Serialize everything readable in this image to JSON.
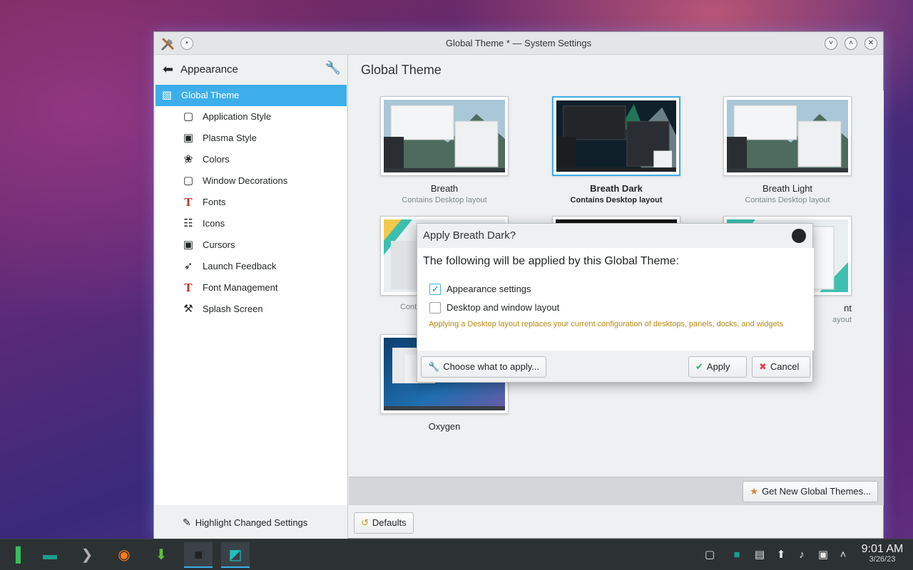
{
  "window": {
    "title": "Global Theme * — System Settings",
    "pin_glyph": "•",
    "controls": [
      {
        "name": "minimize-button",
        "icon": "chevron-down-icon",
        "glyph": "˅"
      },
      {
        "name": "maximize-button",
        "icon": "chevron-up-icon",
        "glyph": "˄"
      },
      {
        "name": "close-button",
        "icon": "close-icon",
        "glyph": "✕"
      }
    ]
  },
  "sidebar": {
    "title": "Appearance",
    "back_glyph": "⬅",
    "tools_glyph": "🔧",
    "items": [
      {
        "label": "Global Theme",
        "icon": "global-theme-icon",
        "glyph": "▧",
        "selected": true,
        "indent": false
      },
      {
        "label": "Application Style",
        "icon": "application-style-icon",
        "glyph": "▢",
        "indent": true
      },
      {
        "label": "Plasma Style",
        "icon": "plasma-style-icon",
        "glyph": "▣",
        "indent": true
      },
      {
        "label": "Colors",
        "icon": "colors-icon",
        "glyph": "❀",
        "indent": true
      },
      {
        "label": "Window Decorations",
        "icon": "window-decorations-icon",
        "glyph": "▢",
        "indent": true
      },
      {
        "label": "Fonts",
        "icon": "fonts-icon",
        "glyph": "T",
        "indent": true
      },
      {
        "label": "Icons",
        "icon": "icons-icon",
        "glyph": "☷",
        "indent": true
      },
      {
        "label": "Cursors",
        "icon": "cursors-icon",
        "glyph": "▣",
        "indent": true
      },
      {
        "label": "Launch Feedback",
        "icon": "launch-feedback-icon",
        "glyph": "➶",
        "indent": true
      },
      {
        "label": "Font Management",
        "icon": "font-management-icon",
        "glyph": "T",
        "indent": true
      },
      {
        "label": "Splash Screen",
        "icon": "splash-screen-icon",
        "glyph": "⚒",
        "indent": true
      }
    ],
    "highlight_label": "Highlight Changed Settings",
    "highlight_glyph": "✎"
  },
  "content": {
    "title": "Global Theme",
    "themes": [
      {
        "name": "Breath",
        "subtitle": "Contains Desktop layout",
        "style": "light"
      },
      {
        "name": "Breath Dark",
        "subtitle": "Contains Desktop layout",
        "style": "dark",
        "selected": true
      },
      {
        "name": "Breath Light",
        "subtitle": "Contains Desktop layout",
        "style": "light"
      },
      {
        "name": "",
        "subtitle": "Cont",
        "style": "yellow"
      },
      {
        "name": "",
        "subtitle": "",
        "style": "black"
      },
      {
        "name": "nt",
        "subtitle": "ayout",
        "style": "yellow2"
      },
      {
        "name": "Oxygen",
        "subtitle": "",
        "style": "oxygen"
      }
    ],
    "get_new_label": "Get New Global Themes...",
    "get_new_glyph": "★",
    "defaults_label": "Defaults",
    "defaults_glyph": "↺"
  },
  "dialog": {
    "title": "Apply Breath Dark?",
    "heading": "The following will be applied by this Global Theme:",
    "options": [
      {
        "label": "Appearance settings",
        "checked": true
      },
      {
        "label": "Desktop and window layout",
        "checked": false
      }
    ],
    "warning": "Applying a Desktop layout replaces your current configuration of desktops, panels, docks, and widgets",
    "choose_label": "Choose what to apply...",
    "choose_glyph": "🔧",
    "apply_label": "Apply",
    "apply_glyph": "✔",
    "cancel_label": "Cancel",
    "cancel_glyph": "✖"
  },
  "taskbar": {
    "items": [
      {
        "name": "app-launcher",
        "icon": "manjaro-logo-icon",
        "glyph": "▐",
        "color": "#35bf5c"
      },
      {
        "name": "file-manager",
        "icon": "folder-icon",
        "glyph": "▬",
        "color": "#1a9e8f"
      },
      {
        "name": "terminal",
        "icon": "terminal-icon",
        "glyph": "❯",
        "color": "#b0b0b0"
      },
      {
        "name": "firefox",
        "icon": "firefox-icon",
        "glyph": "◉",
        "color": "#ff7a1a"
      },
      {
        "name": "software-center",
        "icon": "download-icon",
        "glyph": "⬇",
        "color": "#5fbf3a"
      },
      {
        "name": "konsole",
        "icon": "console-icon",
        "glyph": "■",
        "color": "#222222",
        "active": true
      },
      {
        "name": "system-settings",
        "icon": "settings-icon",
        "glyph": "◩",
        "color": "#22c0c0",
        "active": true
      }
    ],
    "tray": [
      {
        "name": "show-desktop",
        "icon": "desktop-icon",
        "glyph": "▢"
      },
      {
        "name": "pager",
        "icon": "pager-icon",
        "glyph": "■"
      },
      {
        "name": "clipboard",
        "icon": "clipboard-icon",
        "glyph": "▤"
      },
      {
        "name": "updates",
        "icon": "update-icon",
        "glyph": "⬆"
      },
      {
        "name": "volume",
        "icon": "speaker-icon",
        "glyph": "♪"
      },
      {
        "name": "network",
        "icon": "network-icon",
        "glyph": "▣"
      },
      {
        "name": "tray-expand",
        "icon": "chevron-up-icon",
        "glyph": "˄"
      }
    ],
    "time": "9:01 AM",
    "date": "3/26/23"
  },
  "colors": {
    "accent": "#3daee9",
    "warning": "#b88a12"
  }
}
